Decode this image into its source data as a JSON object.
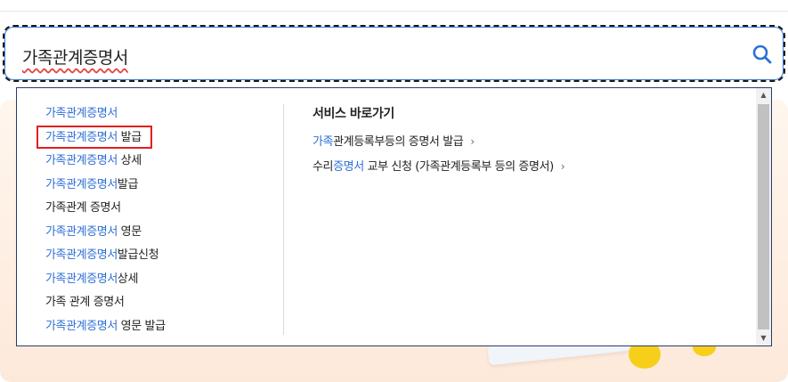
{
  "search": {
    "value": "가족관계증명서",
    "icon": "search-icon",
    "accent_color": "#2f6fd6"
  },
  "suggestions": [
    {
      "hl": "가족관계증명서",
      "rest": ""
    },
    {
      "hl": "가족관계증명서",
      "rest": " 발급"
    },
    {
      "hl": "가족관계증명서",
      "rest": " 상세"
    },
    {
      "hl": "가족관계증명서",
      "rest": "발급"
    },
    {
      "hl": "",
      "rest": "가족관계 증명서"
    },
    {
      "hl": "가족관계증명서",
      "rest": " 영문"
    },
    {
      "hl": "가족관계증명서",
      "rest": "발급신청"
    },
    {
      "hl": "가족관계증명서",
      "rest": "상세"
    },
    {
      "hl": "",
      "rest": "가족 관계 증명서"
    },
    {
      "hl": "가족관계증명서",
      "rest": " 영문 발급"
    }
  ],
  "selected_index": 1,
  "selected_border_color": "#e02020",
  "quick_links": {
    "title": "서비스 바로가기",
    "items": [
      {
        "pre": "",
        "hl": "가족",
        "post": "관계등록부등의 증명서 발급"
      },
      {
        "pre": "수리",
        "hl": "증명서",
        "post": " 교부 신청 (가족관계등록부 등의 증명서)"
      }
    ],
    "chevron": "›"
  }
}
